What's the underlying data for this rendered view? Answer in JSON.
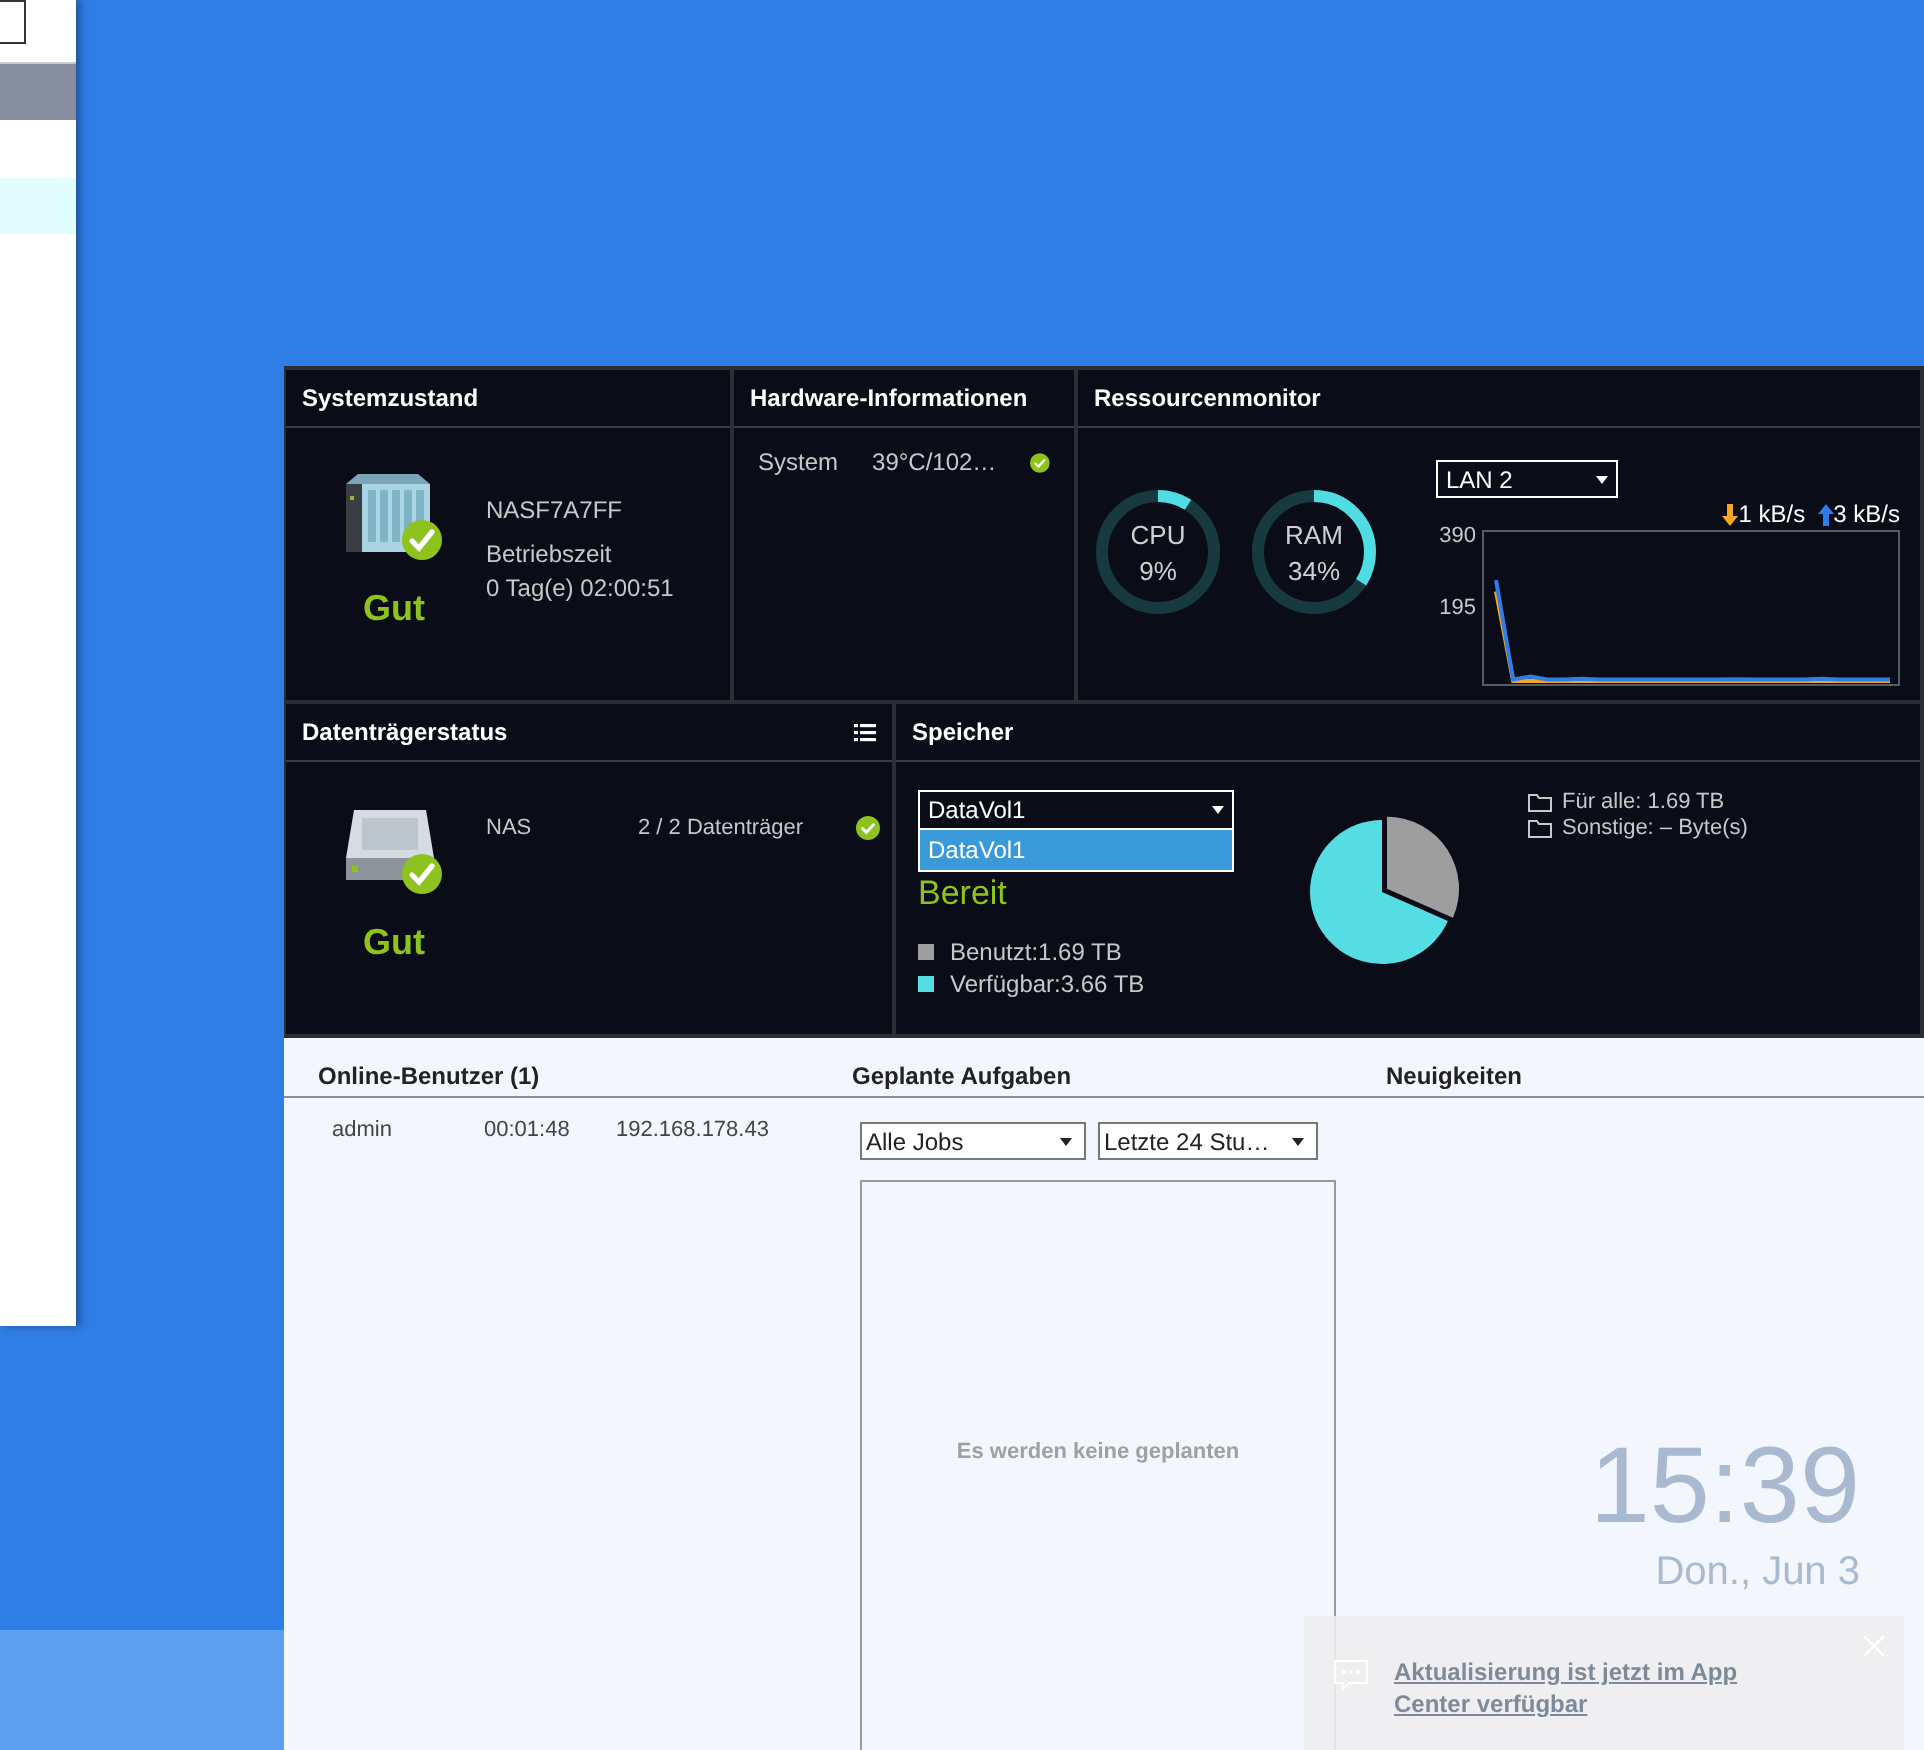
{
  "system_health": {
    "title": "Systemzustand",
    "device_name": "NASF7A7FF",
    "uptime_label": "Betriebszeit",
    "uptime": "0 Tag(e) 02:00:51",
    "status": "Gut"
  },
  "hardware_info": {
    "title": "Hardware-Informationen",
    "rows": [
      {
        "label": "System",
        "value": "39°C/102…"
      }
    ]
  },
  "resource_monitor": {
    "title": "Ressourcenmonitor",
    "gauges": [
      {
        "label": "CPU",
        "reading": "9%",
        "level": 0.09
      },
      {
        "label": "RAM",
        "reading": "34%",
        "level": 0.34
      }
    ],
    "interface_select": "LAN 2",
    "download": "1 kB/s",
    "upload": "3 kB/s",
    "chart_data": {
      "type": "line",
      "ylim": [
        0,
        410
      ],
      "yticks": [
        195,
        390
      ],
      "series": [
        {
          "color": "#f5a623",
          "values": [
            250,
            8,
            8,
            8,
            9,
            8,
            8,
            8,
            8,
            8,
            8,
            8,
            8,
            8,
            8,
            8,
            8,
            8,
            8,
            8,
            8,
            8,
            8,
            8
          ]
        },
        {
          "color": "#2f7de6",
          "values": [
            280,
            12,
            20,
            12,
            12,
            14,
            12,
            12,
            12,
            12,
            12,
            12,
            12,
            12,
            13,
            12,
            12,
            12,
            12,
            14,
            12,
            12,
            12,
            12
          ]
        }
      ]
    }
  },
  "disk_status": {
    "title": "Datenträgerstatus",
    "rows": [
      {
        "name": "NAS",
        "count": "2 / 2 Datenträger"
      }
    ],
    "status": "Gut"
  },
  "storage": {
    "title": "Speicher",
    "volume_select": {
      "value": "DataVol1",
      "expanded": true,
      "options": [
        {
          "label": "DataVol1",
          "selected": true
        }
      ]
    },
    "status": "Bereit",
    "chart_data": {
      "type": "pie",
      "values": [
        31.6,
        68.4
      ]
    },
    "legend": [
      {
        "label": "Benutzt:1.69 TB",
        "color": "#9e9e9e"
      },
      {
        "label": "Verfügbar:3.66 TB",
        "color": "#56dde3"
      }
    ],
    "shares": [
      "Für alle: 1.69 TB",
      "Sonstige: – Byte(s)"
    ]
  },
  "online_users": {
    "title": "Online-Benutzer (1)",
    "rows": [
      {
        "user": "admin",
        "time": "00:01:48",
        "ip": "192.168.178.43"
      }
    ]
  },
  "scheduled_tasks": {
    "title": "Geplante Aufgaben",
    "filters": [
      "Alle Jobs",
      "Letzte 24 Stu…"
    ],
    "empty_message": "Es werden keine geplanten"
  },
  "news": {
    "title": "Neuigkeiten"
  },
  "clock": {
    "time": "15:39",
    "date": "Don., Jun 3"
  },
  "notification": {
    "message": "Aktualisierung ist jetzt im App Center verfügbar"
  }
}
